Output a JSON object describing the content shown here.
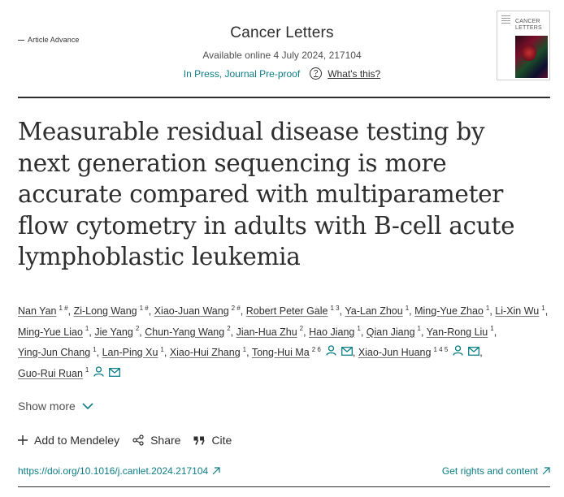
{
  "header": {
    "article_advance": "Article Advance",
    "journal_title": "Cancer Letters",
    "available_online": "Available online 4 July 2024, 217104",
    "status_link": "In Press, Journal Pre-proof",
    "help_label": "What's this?",
    "cover_title": "CANCER LETTERS"
  },
  "article": {
    "title": "Measurable residual disease testing by next generation sequencing is more accurate compared with multiparameter flow cytometry in adults with B-cell acute lymphoblastic leukemia"
  },
  "authors": [
    {
      "name": "Nan Yan",
      "sup": "1 #"
    },
    {
      "name": "Zi-Long Wang",
      "sup": "1 #"
    },
    {
      "name": "Xiao-Juan Wang",
      "sup": "2 #"
    },
    {
      "name": "Robert Peter Gale",
      "sup": "1 3"
    },
    {
      "name": "Ya-Lan Zhou",
      "sup": "1"
    },
    {
      "name": "Ming-Yue Zhao",
      "sup": "1"
    },
    {
      "name": "Li-Xin Wu",
      "sup": "1"
    },
    {
      "name": "Ming-Yue Liao",
      "sup": "1"
    },
    {
      "name": "Jie Yang",
      "sup": "2"
    },
    {
      "name": "Chun-Yang Wang",
      "sup": "2"
    },
    {
      "name": "Jian-Hua Zhu",
      "sup": "2"
    },
    {
      "name": "Hao Jiang",
      "sup": "1"
    },
    {
      "name": "Qian Jiang",
      "sup": "1"
    },
    {
      "name": "Yan-Rong Liu",
      "sup": "1"
    },
    {
      "name": "Ying-Jun Chang",
      "sup": "1"
    },
    {
      "name": "Lan-Ping Xu",
      "sup": "1"
    },
    {
      "name": "Xiao-Hui Zhang",
      "sup": "1"
    },
    {
      "name": "Tong-Hui Ma",
      "sup": "2 6",
      "icons": true
    },
    {
      "name": "Xiao-Jun Huang",
      "sup": "1 4 5",
      "icons": true
    },
    {
      "name": "Guo-Rui Ruan",
      "sup": "1",
      "icons": true
    }
  ],
  "show_more": "Show more",
  "actions": {
    "mendeley": "Add to Mendeley",
    "share": "Share",
    "cite": "Cite"
  },
  "links": {
    "doi": "https://doi.org/10.1016/j.canlet.2024.217104",
    "rights": "Get rights and content"
  },
  "colors": {
    "link": "#0c7d85",
    "text": "#2e2e2e"
  }
}
